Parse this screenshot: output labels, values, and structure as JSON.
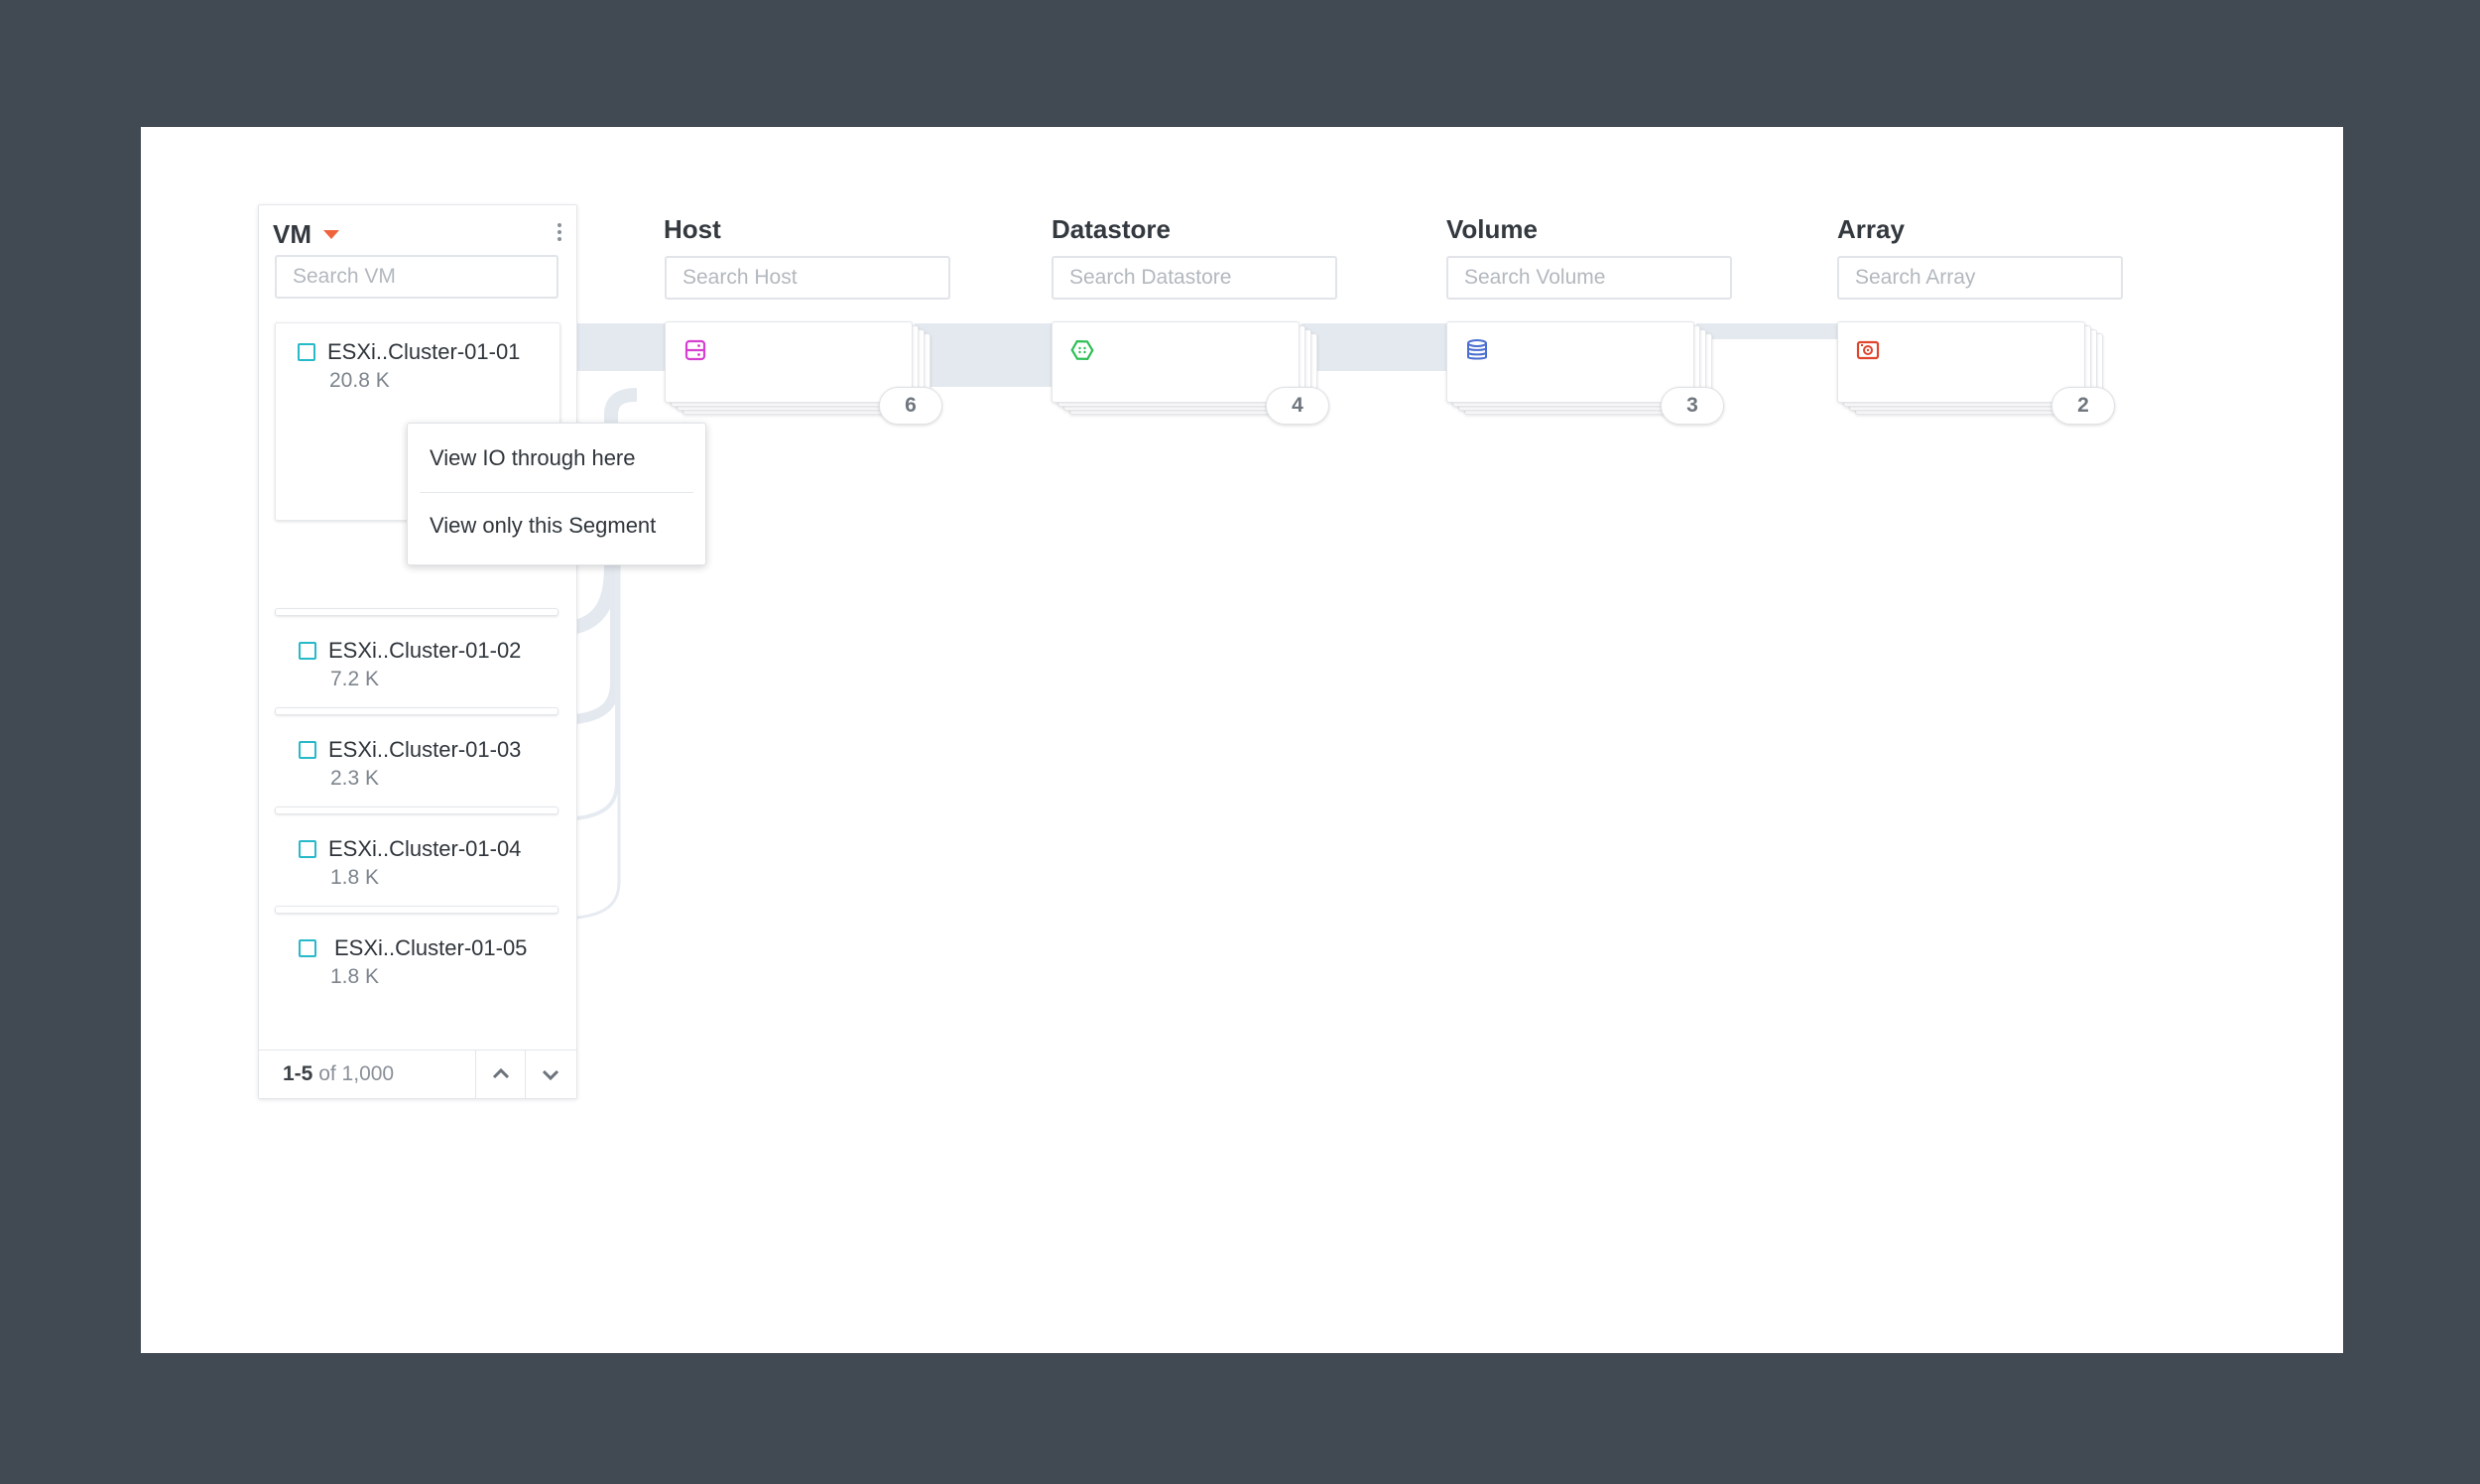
{
  "columns": {
    "vm": {
      "title": "VM",
      "search_placeholder": "Search VM",
      "items": [
        {
          "name": "ESXi..Cluster-01-01",
          "value": "20.8 K"
        },
        {
          "name": "ESXi..Cluster-01-02",
          "value": "7.2 K"
        },
        {
          "name": "ESXi..Cluster-01-03",
          "value": "2.3 K"
        },
        {
          "name": "ESXi..Cluster-01-04",
          "value": "1.8 K"
        },
        {
          "name": "ESXi..Cluster-01-05",
          "value": "1.8 K"
        }
      ],
      "pager": {
        "range": "1-5",
        "of_text": "of 1,000"
      }
    },
    "host": {
      "title": "Host",
      "search_placeholder": "Search Host",
      "count": "6",
      "icon": "server-icon",
      "icon_color": "#d63fd0"
    },
    "datastore": {
      "title": "Datastore",
      "search_placeholder": "Search Datastore",
      "count": "4",
      "icon": "datastore-hexagon-icon",
      "icon_color": "#2fbf55"
    },
    "volume": {
      "title": "Volume",
      "search_placeholder": "Search Volume",
      "count": "3",
      "icon": "database-icon",
      "icon_color": "#4a6fd0"
    },
    "array": {
      "title": "Array",
      "search_placeholder": "Search Array",
      "count": "2",
      "icon": "storage-array-icon",
      "icon_color": "#e0452e"
    }
  },
  "context_menu": {
    "items": [
      "View IO through here",
      "View only this Segment"
    ]
  },
  "colors": {
    "background": "#414a53",
    "flow_band": "#e4e9f0",
    "checkbox": "#26b9c9",
    "caret": "#f0643c"
  }
}
